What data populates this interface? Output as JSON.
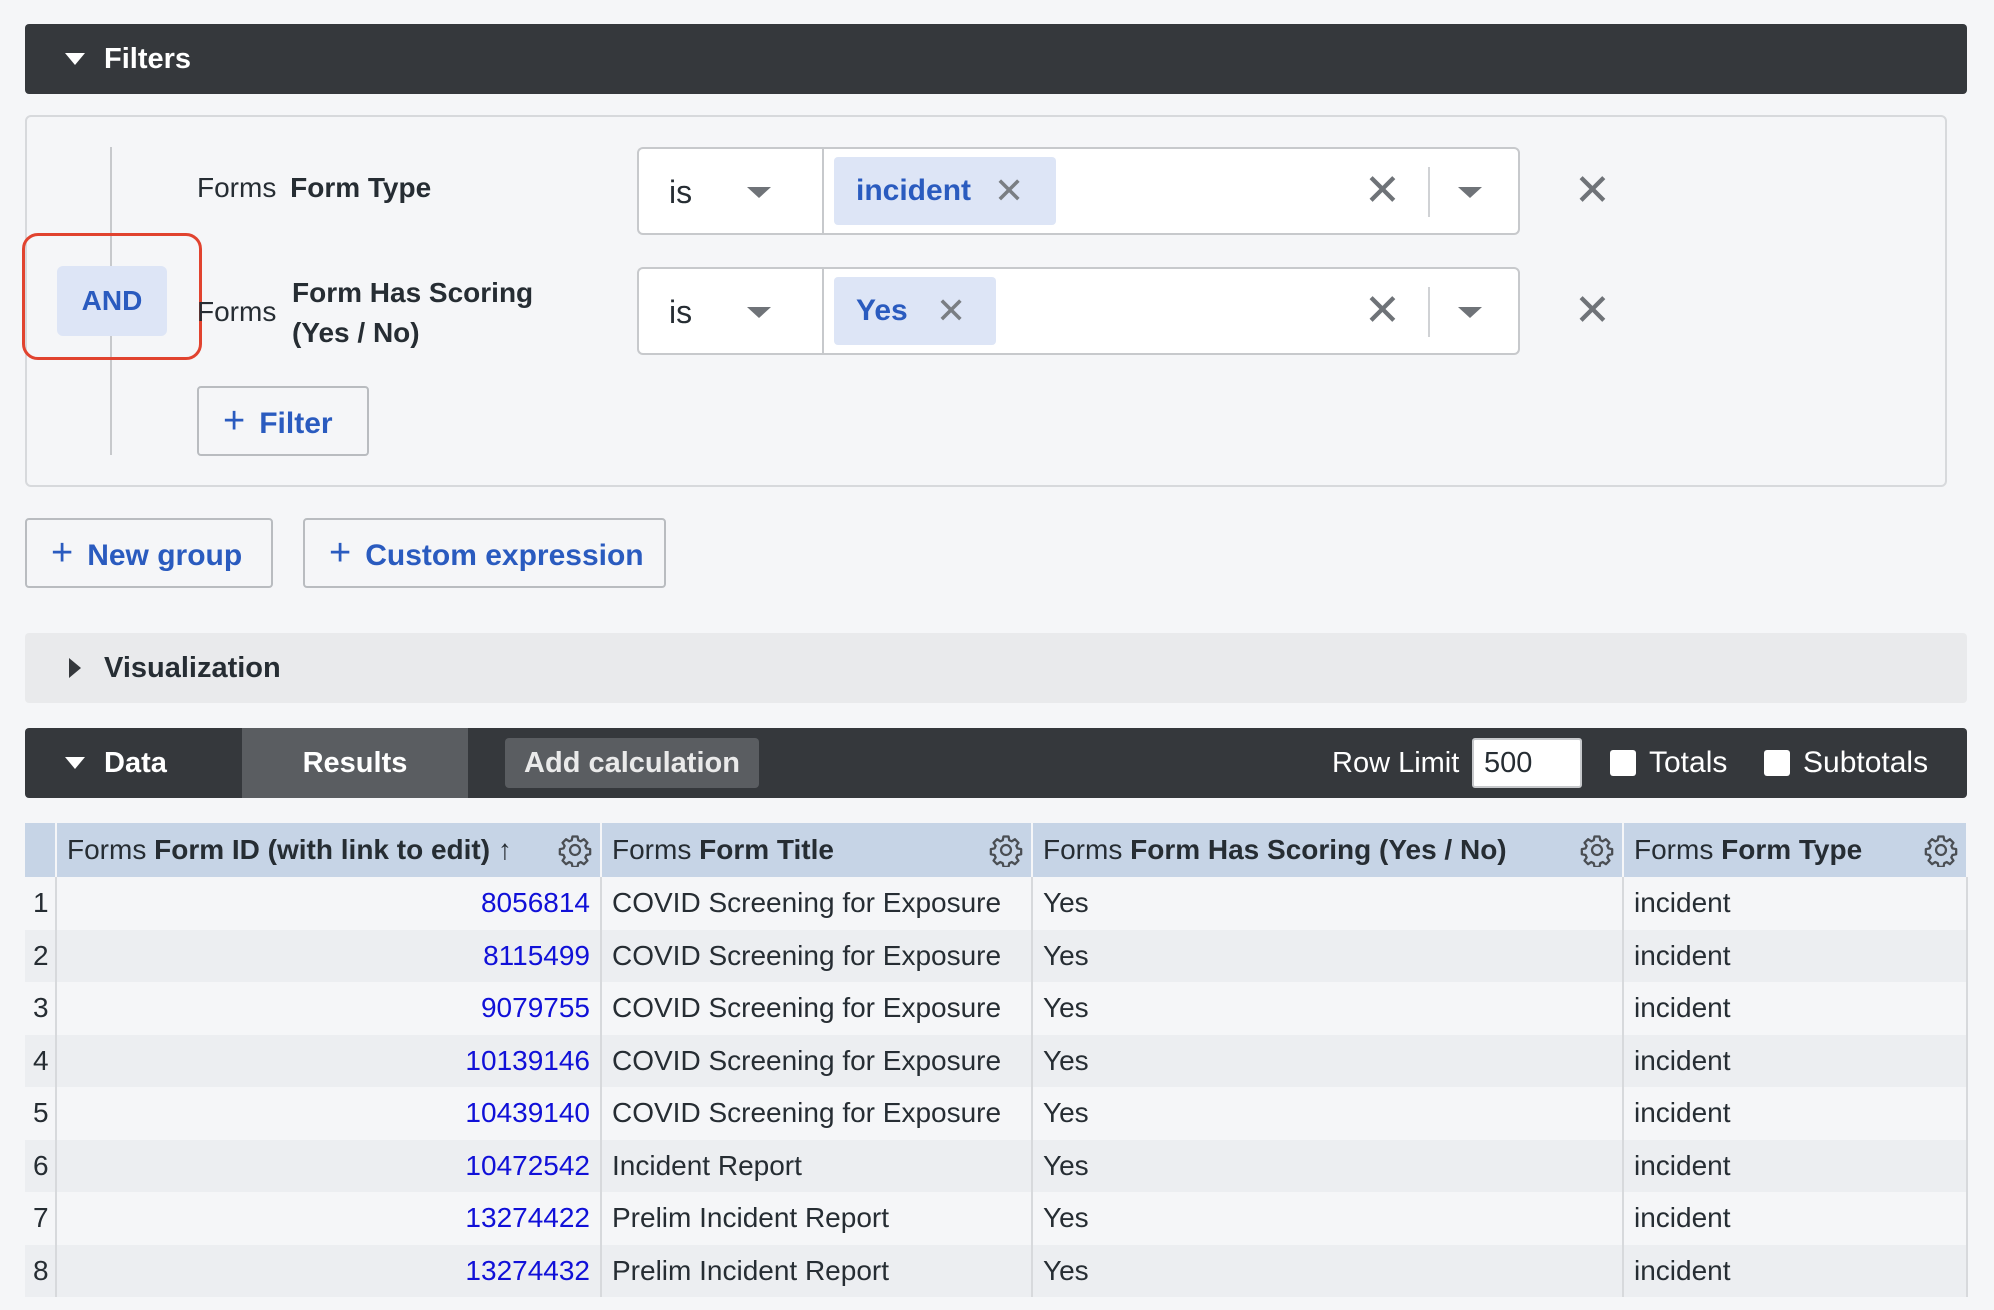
{
  "filters": {
    "title": "Filters",
    "logic_operator": "AND",
    "rows": [
      {
        "view": "Forms",
        "field": "Form Type",
        "field_line2": "",
        "operator": "is",
        "value": "incident"
      },
      {
        "view": "Forms",
        "field": "Form Has Scoring",
        "field_line2": "(Yes / No)",
        "operator": "is",
        "value": "Yes"
      }
    ],
    "add_filter_label": "Filter",
    "new_group_label": "New group",
    "custom_expression_label": "Custom expression"
  },
  "visualization": {
    "title": "Visualization"
  },
  "data": {
    "title": "Data",
    "results_tab": "Results",
    "add_calculation_label": "Add calculation",
    "row_limit_label": "Row Limit",
    "row_limit_value": "500",
    "totals_label": "Totals",
    "subtotals_label": "Subtotals"
  },
  "table": {
    "columns": [
      {
        "view": "Forms",
        "field": "Form ID (with link to edit)",
        "sort": "↑"
      },
      {
        "view": "Forms",
        "field": "Form Title",
        "sort": ""
      },
      {
        "view": "Forms",
        "field": "Form Has Scoring (Yes / No)",
        "sort": ""
      },
      {
        "view": "Forms",
        "field": "Form Type",
        "sort": ""
      }
    ],
    "rows": [
      {
        "index": "1",
        "form_id": "8056814",
        "title": "COVID Screening for Exposure",
        "scoring": "Yes",
        "type": "incident"
      },
      {
        "index": "2",
        "form_id": "8115499",
        "title": "COVID Screening for Exposure",
        "scoring": "Yes",
        "type": "incident"
      },
      {
        "index": "3",
        "form_id": "9079755",
        "title": "COVID Screening for Exposure",
        "scoring": "Yes",
        "type": "incident"
      },
      {
        "index": "4",
        "form_id": "10139146",
        "title": "COVID Screening for Exposure",
        "scoring": "Yes",
        "type": "incident"
      },
      {
        "index": "5",
        "form_id": "10439140",
        "title": "COVID Screening for Exposure",
        "scoring": "Yes",
        "type": "incident"
      },
      {
        "index": "6",
        "form_id": "10472542",
        "title": "Incident Report",
        "scoring": "Yes",
        "type": "incident"
      },
      {
        "index": "7",
        "form_id": "13274422",
        "title": "Prelim Incident Report",
        "scoring": "Yes",
        "type": "incident"
      },
      {
        "index": "8",
        "form_id": "13274432",
        "title": "Prelim Incident Report",
        "scoring": "Yes",
        "type": "incident"
      }
    ]
  },
  "colors": {
    "header_dark": "#35383c",
    "accent_blue": "#2a5bbf",
    "link_blue": "#1010d8",
    "highlight_red": "#e1432f",
    "table_header": "#c6d4e6"
  },
  "icons": {
    "collapse": "triangle-down-icon",
    "expand": "triangle-right-icon",
    "remove": "close-icon",
    "dropdown": "chevron-down-icon",
    "add": "plus-icon",
    "settings": "gear-icon",
    "sort": "arrow-up-icon"
  }
}
